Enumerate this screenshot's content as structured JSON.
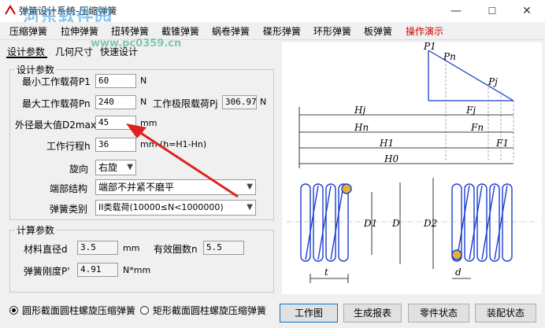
{
  "window": {
    "title": "弹簧设计系统-压缩弹簧",
    "watermark": "河东软件园",
    "watermark_url": "www.pc0359.cn",
    "controls": {
      "minimize": "—",
      "maximize": "☐",
      "close": "✕"
    }
  },
  "menu": {
    "items": [
      "压缩弹簧",
      "拉伸弹簧",
      "扭转弹簧",
      "截锥弹簧",
      "蜗卷弹簧",
      "碟形弹簧",
      "环形弹簧",
      "板弹簧",
      "操作演示"
    ],
    "accent_color": "#cc0000"
  },
  "tabs": [
    "设计参数",
    "几何尺寸",
    "快速设计"
  ],
  "design": {
    "group_title": "设计参数",
    "p1_label": "最小工作载荷P1",
    "p1_value": "60",
    "p1_unit": "N",
    "pn_label": "最大工作载荷Pn",
    "pn_value": "240",
    "pn_unit": "N",
    "pj_label": "工作极限载荷Pj",
    "pj_value": "306.97",
    "pj_unit": "N",
    "d2_label": "外径最大值D2max",
    "d2_value": "45",
    "d2_unit": "mm",
    "h_label": "工作行程h",
    "h_value": "36",
    "h_unit": "mm (h=H1-Hn)",
    "dir_label": "旋向",
    "dir_value": "右旋",
    "end_label": "端部结构",
    "end_value": "端部不并紧不磨平",
    "type_label": "弹簧类别",
    "type_value": "II类载荷(10000≤N<1000000)"
  },
  "calc": {
    "group_title": "计算参数",
    "d_label": "材料直径d",
    "d_value": "3.5",
    "d_unit": "mm",
    "n_label": "有效圈数n",
    "n_value": "5.5",
    "k_label": "弹簧刚度P'",
    "k_value": "4.91",
    "k_unit": "N*mm"
  },
  "radios": {
    "round": "圆形截面圆柱螺旋压缩弹簧",
    "rect": "矩形截面圆柱螺旋压缩弹簧",
    "selected": "round"
  },
  "buttons": [
    "工作图",
    "生成报表",
    "零件状态",
    "装配状态"
  ],
  "diagram": {
    "labels": [
      "P1",
      "Pn",
      "Pj",
      "Hj",
      "Fj",
      "Hn",
      "Fn",
      "H1",
      "F1",
      "H0",
      "D1",
      "D",
      "D2",
      "t",
      "d"
    ],
    "spring_color": "#1a3ecf"
  },
  "annotation_color": "#e02020"
}
